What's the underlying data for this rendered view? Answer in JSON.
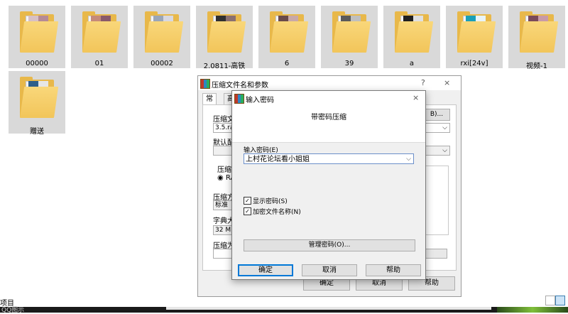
{
  "folders": [
    {
      "name": "00000",
      "thumbs": [
        "#d7c0c5",
        "#b58a96"
      ]
    },
    {
      "name": "01",
      "thumbs": [
        "#c58a7a",
        "#8a5a6a"
      ]
    },
    {
      "name": "00002",
      "thumbs": [
        "#9aa6b8",
        "#d8d8e0"
      ]
    },
    {
      "name": "2.0811-高铁",
      "thumbs": [
        "#303030",
        "#8a7070"
      ]
    },
    {
      "name": "6",
      "thumbs": [
        "#6a4a4a",
        "#c8a8a8"
      ]
    },
    {
      "name": "39",
      "thumbs": [
        "#5a5a5a",
        "#bfbfbf"
      ]
    },
    {
      "name": "a",
      "thumbs": [
        "#202020",
        "#e0e0e0"
      ]
    },
    {
      "name": "rxi[24v]",
      "thumbs": [
        "#1aa0b8",
        "#e8f4f8"
      ]
    },
    {
      "name": "视频-1",
      "thumbs": [
        "#7a4a5a",
        "#c89aa8"
      ]
    },
    {
      "name": "赠送",
      "thumbs": [
        "#2e5f8a",
        "#e6e6e6"
      ]
    }
  ],
  "status_bar": {
    "item_count_text": "项目"
  },
  "taskbar": {
    "text": "QQ图示"
  },
  "archive_dialog": {
    "title": "压缩文件名和参数",
    "help_btn": "?",
    "close_btn": "×",
    "tabs": [
      "常规",
      "高"
    ],
    "labels": {
      "archive_name": "压缩文",
      "default_profile": "默认配",
      "archive_format": "压缩文",
      "method": "压缩方",
      "dict_size": "字典大",
      "split": "压缩为"
    },
    "fields": {
      "archive_name_value": "3.5.ra",
      "method_value": "标准",
      "dict_value": "32 MB",
      "format_rar": "RA"
    },
    "browse_btn": "B)...",
    "ok_btn": "确定",
    "cancel_btn": "取消",
    "help_bottom_btn": "帮助"
  },
  "password_dialog": {
    "title": "输入密码",
    "close_btn": "×",
    "subtitle": "带密码压缩",
    "input_label": "输入密码(E)",
    "input_value": "上村花论坛看小姐姐",
    "show_password_label": "显示密码(S)",
    "show_password_checked": true,
    "encrypt_names_label": "加密文件名称(N)",
    "encrypt_names_checked": true,
    "manage_btn": "管理密码(O)...",
    "ok_btn": "确定",
    "cancel_btn": "取消",
    "help_btn": "帮助"
  }
}
